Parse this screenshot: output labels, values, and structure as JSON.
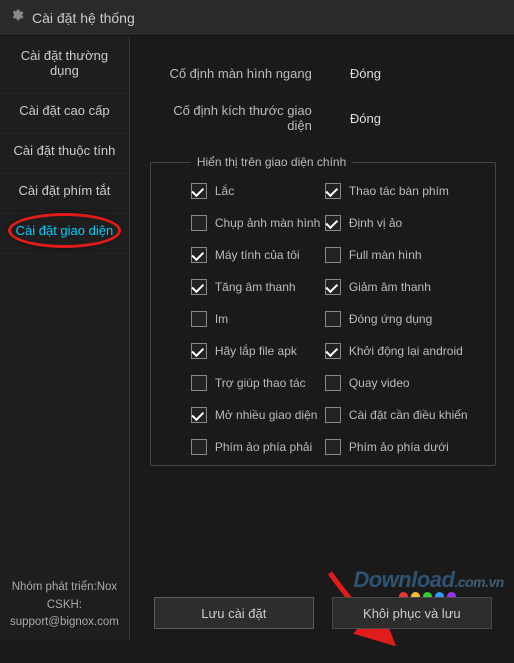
{
  "title": "Cài đặt hệ thống",
  "sidebar": {
    "items": [
      {
        "label": "Cài đặt thường dụng"
      },
      {
        "label": "Cài đặt cao cấp"
      },
      {
        "label": "Cài đặt thuộc tính"
      },
      {
        "label": "Cài đặt phím tắt"
      },
      {
        "label": "Cài đặt giao diện"
      }
    ],
    "footer_dev": "Nhóm phát triển:Nox",
    "footer_cskh": "CSKH:",
    "footer_email": "support@bignox.com"
  },
  "rows": {
    "fixed_landscape_label": "Cố định màn hình ngang",
    "fixed_landscape_value": "Đóng",
    "fixed_size_label": "Cố định kích thước giao diện",
    "fixed_size_value": "Đóng"
  },
  "fieldset_legend": "Hiển thị trên giao diện chính",
  "checks": [
    {
      "label": "Lắc",
      "checked": true
    },
    {
      "label": "Thao tác bàn phím",
      "checked": true
    },
    {
      "label": "Chụp ảnh màn hình",
      "checked": false
    },
    {
      "label": "Định vị ảo",
      "checked": true
    },
    {
      "label": "Máy tính của tôi",
      "checked": true
    },
    {
      "label": "Full màn hình",
      "checked": false
    },
    {
      "label": "Tăng âm thanh",
      "checked": true
    },
    {
      "label": "Giảm âm thanh",
      "checked": true
    },
    {
      "label": "Im",
      "checked": false
    },
    {
      "label": "Đóng ứng dụng",
      "checked": false
    },
    {
      "label": "Hãy lắp file apk",
      "checked": true
    },
    {
      "label": "Khởi động lại android",
      "checked": true
    },
    {
      "label": "Trợ giúp thao tác",
      "checked": false
    },
    {
      "label": "Quay video",
      "checked": false
    },
    {
      "label": "Mở nhiều giao diện",
      "checked": true
    },
    {
      "label": "Cài đặt cần điều khiển",
      "checked": false
    },
    {
      "label": "Phím ảo phía phải",
      "checked": false
    },
    {
      "label": "Phím ảo phía dưới",
      "checked": false
    }
  ],
  "buttons": {
    "save": "Lưu cài đặt",
    "restore": "Khôi phục và lưu"
  },
  "watermark": "Download",
  "watermark_tail": ".com.vn"
}
